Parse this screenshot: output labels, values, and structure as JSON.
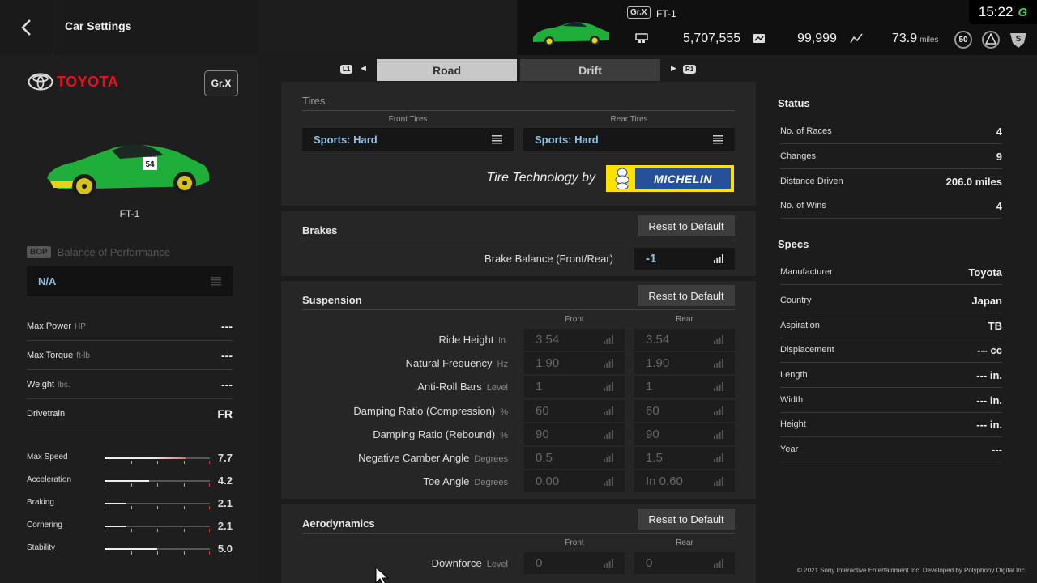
{
  "header": {
    "title": "Car Settings",
    "car_class": "Gr.X",
    "car_name": "FT-1",
    "credits": "5,707,555",
    "mileage_points": "99,999",
    "distance": "73.9",
    "distance_unit": "miles",
    "level": "50",
    "clock": "15:22",
    "gt_logo": "G"
  },
  "car": {
    "brand": "TOYOTA",
    "class": "Gr.X",
    "name": "FT-1",
    "bop_tag": "BOP",
    "bop_label": "Balance of Performance",
    "bop_value": "N/A",
    "specs": [
      {
        "label": "Max Power",
        "unit": "HP",
        "value": "---"
      },
      {
        "label": "Max Torque",
        "unit": "ft-lb",
        "value": "---"
      },
      {
        "label": "Weight",
        "unit": "lbs.",
        "value": "---"
      },
      {
        "label": "Drivetrain",
        "unit": "",
        "value": "FR"
      }
    ],
    "performance": [
      {
        "label": "Max Speed",
        "value": "7.7",
        "fraction": 0.77
      },
      {
        "label": "Acceleration",
        "value": "4.2",
        "fraction": 0.42
      },
      {
        "label": "Braking",
        "value": "2.1",
        "fraction": 0.21
      },
      {
        "label": "Cornering",
        "value": "2.1",
        "fraction": 0.21
      },
      {
        "label": "Stability",
        "value": "5.0",
        "fraction": 0.5
      }
    ]
  },
  "tabs": {
    "left_button": "L1",
    "right_button": "R1",
    "road": "Road",
    "drift": "Drift"
  },
  "tires": {
    "title": "Tires",
    "front_head": "Front Tires",
    "rear_head": "Rear Tires",
    "front": "Sports: Hard",
    "rear": "Sports: Hard",
    "tech_text": "Tire Technology by",
    "brand_logo": "MICHELIN"
  },
  "brakes": {
    "title": "Brakes",
    "reset": "Reset to Default",
    "param_label": "Brake Balance (Front/Rear)",
    "param_value": "-1"
  },
  "suspension": {
    "title": "Suspension",
    "reset": "Reset to Default",
    "front_head": "Front",
    "rear_head": "Rear",
    "rows": [
      {
        "label": "Ride Height",
        "unit": "in.",
        "front": "3.54",
        "rear": "3.54"
      },
      {
        "label": "Natural Frequency",
        "unit": "Hz",
        "front": "1.90",
        "rear": "1.90"
      },
      {
        "label": "Anti-Roll Bars",
        "unit": "Level",
        "front": "1",
        "rear": "1"
      },
      {
        "label": "Damping Ratio (Compression)",
        "unit": "%",
        "front": "60",
        "rear": "60"
      },
      {
        "label": "Damping Ratio (Rebound)",
        "unit": "%",
        "front": "90",
        "rear": "90"
      },
      {
        "label": "Negative Camber Angle",
        "unit": "Degrees",
        "front": "0.5",
        "rear": "1.5"
      },
      {
        "label": "Toe Angle",
        "unit": "Degrees",
        "front": "0.00",
        "rear": "In 0.60"
      }
    ]
  },
  "aero": {
    "title": "Aerodynamics",
    "reset": "Reset to Default",
    "front_head": "Front",
    "rear_head": "Rear",
    "param_label": "Downforce",
    "param_unit": "Level",
    "front": "0",
    "rear": "0"
  },
  "status": {
    "title": "Status",
    "rows": [
      {
        "label": "No. of Races",
        "value": "4"
      },
      {
        "label": "Changes",
        "value": "9"
      },
      {
        "label": "Distance Driven",
        "value": "206.0 miles"
      },
      {
        "label": "No. of Wins",
        "value": "4"
      }
    ]
  },
  "specs": {
    "title": "Specs",
    "rows": [
      {
        "label": "Manufacturer",
        "value": "Toyota"
      },
      {
        "label": "Country",
        "value": "Japan"
      },
      {
        "label": "Aspiration",
        "value": "TB"
      },
      {
        "label": "Displacement",
        "value": "--- cc"
      },
      {
        "label": "Length",
        "value": "--- in."
      },
      {
        "label": "Width",
        "value": "--- in."
      },
      {
        "label": "Height",
        "value": "--- in."
      },
      {
        "label": "Year",
        "value": "---"
      }
    ]
  },
  "footer": {
    "copyright": "© 2021 Sony Interactive Entertainment Inc. Developed by Polyphony Digital Inc."
  },
  "colors": {
    "accent_blue": "#8fc0e0",
    "toyota_red": "#e8101e",
    "michelin_yellow": "#fde100",
    "michelin_blue": "#27509b",
    "car_green": "#1fae3a"
  }
}
